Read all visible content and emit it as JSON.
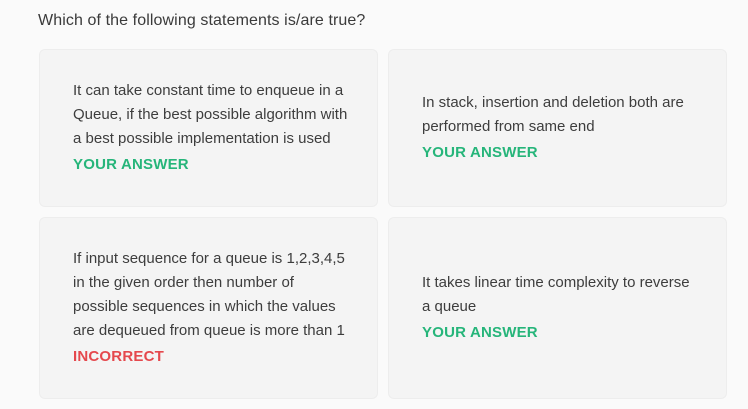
{
  "question": {
    "text": "Which of the following statements is/are true?"
  },
  "options": [
    {
      "text": "It can take constant time to enqueue in a Queue, if the best possible algorithm with a best possible implementation is used",
      "status": "YOUR ANSWER",
      "status_color": "#26b57a"
    },
    {
      "text": "In stack, insertion and deletion both are performed from same end",
      "status": "YOUR ANSWER",
      "status_color": "#26b57a"
    },
    {
      "text": "If input sequence for a queue is 1,2,3,4,5 in the given order then number of possible sequences in which the values are dequeued from queue is more than 1",
      "status": "INCORRECT",
      "status_color": "#e5484d"
    },
    {
      "text": "It takes linear time complexity to reverse a queue",
      "status": "YOUR ANSWER",
      "status_color": "#26b57a"
    }
  ]
}
